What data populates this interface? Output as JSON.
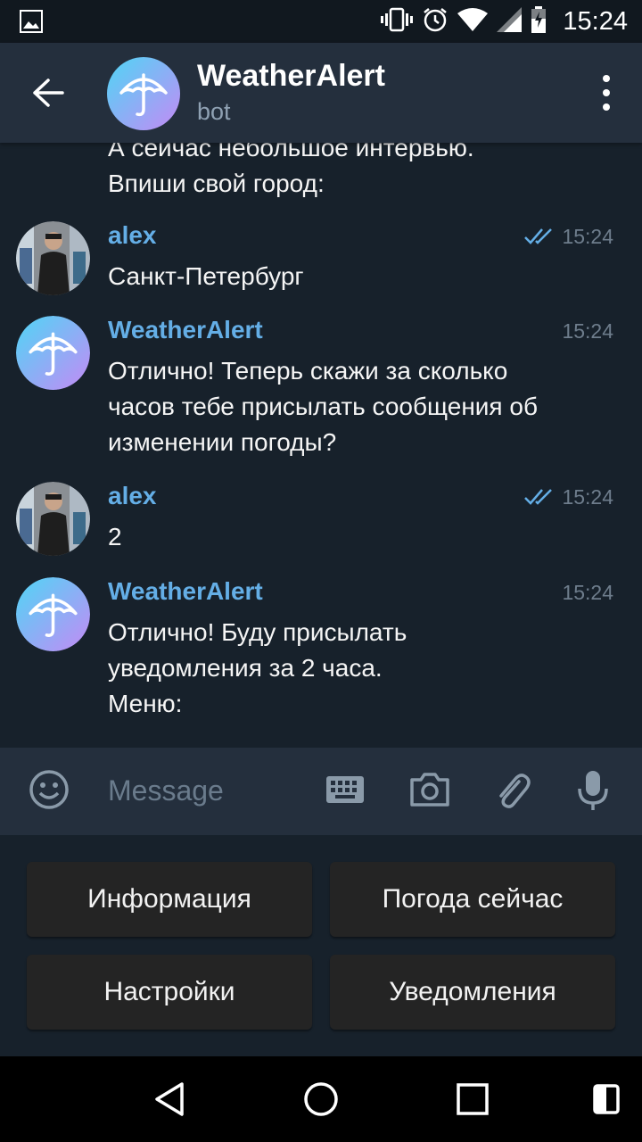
{
  "status_bar": {
    "time": "15:24"
  },
  "header": {
    "title": "WeatherAlert",
    "subtitle": "bot"
  },
  "messages": {
    "partial": {
      "text": "А сейчас небольшое интервью.\nВпиши свой город:"
    },
    "m1": {
      "name": "alex",
      "time": "15:24",
      "text": "Санкт-Петербург"
    },
    "m2": {
      "name": "WeatherAlert",
      "time": "15:24",
      "text": "Отлично! Теперь скажи за сколько\nчасов тебе присылать сообщения об\nизменении погоды?"
    },
    "m3": {
      "name": "alex",
      "time": "15:24",
      "text": "2"
    },
    "m4": {
      "name": "WeatherAlert",
      "time": "15:24",
      "text": "Отлично! Буду присылать\nуведомления за 2 часа.\nМеню:"
    }
  },
  "input": {
    "placeholder": "Message"
  },
  "keyboard": {
    "btn1": "Информация",
    "btn2": "Погода сейчас",
    "btn3": "Настройки",
    "btn4": "Уведомления"
  },
  "colors": {
    "background": "#17212b",
    "header": "#242f3d",
    "name_accent": "#64aee6",
    "bot_gradient_start": "#4fd6f5",
    "bot_gradient_end": "#b98cf5"
  },
  "icons": {
    "status": [
      "image-icon",
      "vibrate-icon",
      "alarm-icon",
      "wifi-icon",
      "signal-icon",
      "battery-icon"
    ],
    "input": [
      "emoji-icon",
      "keyboard-icon",
      "camera-icon",
      "attach-icon",
      "mic-icon"
    ],
    "nav": [
      "back-nav-icon",
      "home-nav-icon",
      "recents-nav-icon",
      "nav-switch-icon"
    ]
  }
}
